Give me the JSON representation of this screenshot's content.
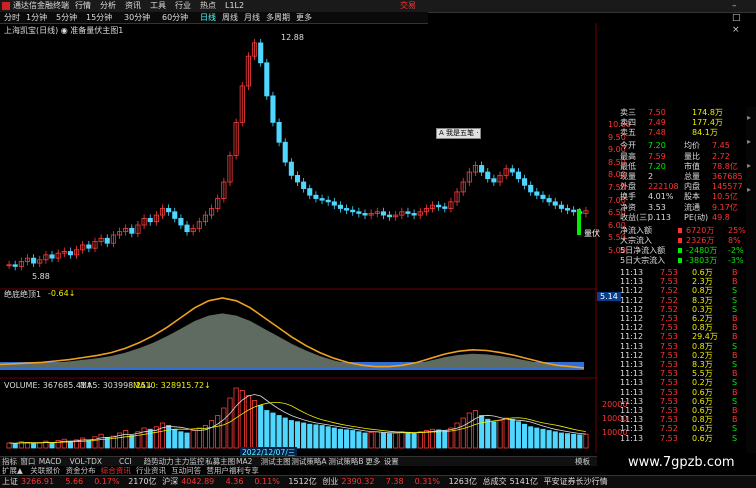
{
  "app_title": "通达信金融终端",
  "menu": [
    "行情",
    "分析",
    "资讯",
    "工具",
    "行业",
    "热点",
    "L1L2"
  ],
  "brand": "交易",
  "window_buttons": "– □ ×",
  "periods": [
    {
      "label": "分时",
      "active": false
    },
    {
      "label": "1分钟",
      "active": false
    },
    {
      "label": "5分钟",
      "active": false
    },
    {
      "label": "15分钟",
      "active": false
    },
    {
      "label": "30分钟",
      "active": false
    },
    {
      "label": "60分钟",
      "active": false
    },
    {
      "label": "日线",
      "active": true
    },
    {
      "label": "周线",
      "active": false
    },
    {
      "label": "月线",
      "active": false
    },
    {
      "label": "多周期",
      "active": false
    },
    {
      "label": "更多",
      "active": false
    }
  ],
  "stock_title": "上海凯宝(日线) ◉ 准备量伏主图1",
  "high_label": "12.88",
  "low_label": "5.88",
  "buy_label": "量伏",
  "popup": "A 我是五笔 ·",
  "indicator": {
    "title": "绝底绝顶1",
    "value": "-0.64↓",
    "side": "5.14"
  },
  "volume": {
    "title": "VOLUME: 367685.41↑",
    "ma5": "MA5: 303998.25↓",
    "ma10": "MA10: 328915.72↓"
  },
  "axis_price": [
    "10.00",
    "9.50",
    "9.00",
    "8.50",
    "8.00",
    "7.50",
    "7.00",
    "6.50",
    "6.00",
    "5.50",
    "5.00"
  ],
  "axis_volume": [
    "20000",
    "10000",
    "10000"
  ],
  "quote_rows": [
    {
      "label": "卖三",
      "price": "7.50",
      "vol": "174.8万",
      "pc": "red"
    },
    {
      "label": "卖四",
      "price": "7.49",
      "vol": "177.4万",
      "pc": "red"
    },
    {
      "label": "卖五",
      "price": "7.48",
      "vol": "84.1万",
      "pc": "red"
    },
    {
      "label": "今开",
      "price": "7.20",
      "label2": "均价",
      "val2": "7.45",
      "pc": "green"
    },
    {
      "label": "最高",
      "price": "7.59",
      "label2": "量比",
      "val2": "2.72",
      "pc": "red"
    },
    {
      "label": "最低",
      "price": "7.20",
      "label2": "市值",
      "val2": "78.8亿",
      "pc": "green"
    },
    {
      "label": "现量",
      "price": "2",
      "label2": "总量",
      "val2": "367685",
      "pc": "white"
    },
    {
      "label": "外盘",
      "price": "222108",
      "label2": "内盘",
      "val2": "145577",
      "pc": "red"
    },
    {
      "label": "换手",
      "price": "4.01%",
      "label2": "股本",
      "val2": "10.5亿",
      "pc": "white"
    },
    {
      "label": "净资",
      "price": "3.53",
      "label2": "流通",
      "val2": "9.17亿",
      "pc": "white"
    },
    {
      "label": "收益(三)",
      "price": "0.113",
      "label2": "PE(动)",
      "val2": "49.8",
      "pc": "white"
    }
  ],
  "flow_rows": [
    {
      "label": "净流入额",
      "val": "6720万",
      "pct": "25%",
      "c": "red"
    },
    {
      "label": "大宗流入",
      "val": "2326万",
      "pct": "8%",
      "c": "red"
    },
    {
      "label": "5日净流入额",
      "val": "-2480万",
      "pct": "-2%",
      "c": "green"
    },
    {
      "label": "5日大宗流入",
      "val": "-3803万",
      "pct": "-3%",
      "c": "green"
    }
  ],
  "ticks": [
    {
      "t": "11:13",
      "p": "7.53",
      "v": "0.6万",
      "f": "B",
      "c": "red"
    },
    {
      "t": "11:13",
      "p": "7.53",
      "v": "2.3万",
      "f": "B",
      "c": "red"
    },
    {
      "t": "11:12",
      "p": "7.52",
      "v": "0.8万",
      "f": "S",
      "c": "red"
    },
    {
      "t": "11:12",
      "p": "7.52",
      "v": "8.3万",
      "f": "S",
      "c": "red"
    },
    {
      "t": "11:12",
      "p": "7.52",
      "v": "0.3万",
      "f": "S",
      "c": "red"
    },
    {
      "t": "11:12",
      "p": "7.53",
      "v": "6.2万",
      "f": "B",
      "c": "red"
    },
    {
      "t": "11:12",
      "p": "7.53",
      "v": "0.8万",
      "f": "B",
      "c": "red"
    },
    {
      "t": "11:12",
      "p": "7.53",
      "v": "29.4万",
      "f": "B",
      "c": "red"
    },
    {
      "t": "11:13",
      "p": "7.53",
      "v": "0.8万",
      "f": "S",
      "c": "red"
    },
    {
      "t": "11:12",
      "p": "7.53",
      "v": "0.2万",
      "f": "B",
      "c": "red"
    },
    {
      "t": "11:13",
      "p": "7.53",
      "v": "8.3万",
      "f": "S",
      "c": "red"
    },
    {
      "t": "11:13",
      "p": "7.53",
      "v": "5.5万",
      "f": "B",
      "c": "red"
    },
    {
      "t": "11:13",
      "p": "7.53",
      "v": "0.2万",
      "f": "S",
      "c": "red"
    },
    {
      "t": "11:13",
      "p": "7.53",
      "v": "0.6万",
      "f": "B",
      "c": "red"
    },
    {
      "t": "11:13",
      "p": "7.53",
      "v": "0.6万",
      "f": "S",
      "c": "red"
    },
    {
      "t": "11:13",
      "p": "7.53",
      "v": "0.6万",
      "f": "B",
      "c": "red"
    },
    {
      "t": "11:13",
      "p": "7.53",
      "v": "0.8万",
      "f": "B",
      "c": "red"
    },
    {
      "t": "11:13",
      "p": "7.52",
      "v": "0.6万",
      "f": "S",
      "c": "red"
    },
    {
      "t": "11:13",
      "p": "7.53",
      "v": "0.6万",
      "f": "S",
      "c": "red"
    }
  ],
  "date_tag": "2022/12/07/三",
  "tabs": [
    "指标",
    "窗口",
    "MACD",
    "VOL-TDX",
    "CCI",
    "趋势动力",
    "主力监控",
    "私募主图",
    "MA2",
    "测试主图",
    "测试策略A",
    "测试策略B",
    "更多",
    "设置"
  ],
  "tabs2": [
    "扩展▲",
    "关联报价",
    "资金分布",
    "综合资讯",
    "行业资讯",
    "互动问答",
    "营用户福利专享"
  ],
  "tabs_right": "模板",
  "status": [
    {
      "label": "上证",
      "val": "3266.91",
      "c": "red"
    },
    {
      "label": "",
      "val": "5.66",
      "c": "red"
    },
    {
      "label": "",
      "val": "0.17%",
      "c": "red"
    },
    {
      "label": "",
      "val": "2170亿",
      "c": "white"
    },
    {
      "label": "沪深",
      "val": "4042.89",
      "c": "red"
    },
    {
      "label": "",
      "val": "4.36",
      "c": "red"
    },
    {
      "label": "",
      "val": "0.11%",
      "c": "red"
    },
    {
      "label": "",
      "val": "1512亿",
      "c": "white"
    },
    {
      "label": "创业",
      "val": "2390.32",
      "c": "red"
    },
    {
      "label": "",
      "val": "7.38",
      "c": "red"
    },
    {
      "label": "",
      "val": "0.31%",
      "c": "red"
    },
    {
      "label": "",
      "val": "1263亿",
      "c": "white"
    },
    {
      "label": "总成交",
      "val": "5141亿",
      "c": "white"
    },
    {
      "label": "平安证券长沙行情",
      "val": "",
      "c": "white"
    }
  ],
  "watermark": "www.7gpzb.com",
  "chart_data": {
    "type": "candlestick",
    "price_min": 5.0,
    "price_max": 10.3,
    "high_mark": 12.88,
    "closes": [
      5.9,
      5.85,
      6.0,
      6.1,
      5.95,
      6.05,
      6.2,
      6.1,
      6.25,
      6.3,
      6.2,
      6.35,
      6.5,
      6.4,
      6.6,
      6.7,
      6.55,
      6.8,
      6.9,
      7.0,
      6.85,
      7.1,
      7.3,
      7.2,
      7.4,
      7.6,
      7.5,
      7.3,
      7.1,
      6.9,
      7.0,
      7.2,
      7.4,
      7.6,
      7.9,
      8.4,
      9.2,
      10.2,
      11.3,
      12.2,
      12.6,
      12.0,
      11.0,
      10.2,
      9.6,
      9.0,
      8.6,
      8.4,
      8.2,
      8.0,
      7.9,
      7.85,
      7.8,
      7.7,
      7.6,
      7.55,
      7.5,
      7.45,
      7.4,
      7.45,
      7.5,
      7.4,
      7.35,
      7.4,
      7.5,
      7.45,
      7.4,
      7.5,
      7.6,
      7.7,
      7.65,
      7.6,
      7.8,
      8.1,
      8.4,
      8.7,
      8.9,
      8.7,
      8.5,
      8.4,
      8.6,
      8.8,
      8.7,
      8.5,
      8.3,
      8.1,
      8.0,
      7.9,
      7.8,
      7.7,
      7.6,
      7.55,
      7.5,
      7.45,
      7.53
    ],
    "volumes": [
      40,
      35,
      50,
      45,
      38,
      42,
      55,
      40,
      60,
      70,
      50,
      65,
      80,
      60,
      90,
      110,
      85,
      95,
      120,
      140,
      100,
      130,
      160,
      150,
      170,
      200,
      180,
      150,
      130,
      120,
      140,
      160,
      180,
      220,
      260,
      320,
      400,
      480,
      460,
      420,
      380,
      340,
      300,
      280,
      260,
      240,
      220,
      210,
      200,
      190,
      185,
      180,
      170,
      160,
      150,
      145,
      140,
      130,
      120,
      125,
      130,
      120,
      115,
      120,
      130,
      125,
      120,
      130,
      140,
      150,
      145,
      140,
      160,
      200,
      240,
      280,
      300,
      260,
      230,
      210,
      220,
      240,
      230,
      210,
      190,
      170,
      160,
      150,
      140,
      130,
      120,
      115,
      110,
      105,
      110
    ],
    "indicator_curve": [
      0.05,
      0.06,
      0.07,
      0.08,
      0.1,
      0.12,
      0.15,
      0.18,
      0.22,
      0.28,
      0.36,
      0.46,
      0.58,
      0.72,
      0.86,
      0.96,
      1.0,
      0.96,
      0.86,
      0.72,
      0.58,
      0.44,
      0.32,
      0.22,
      0.14,
      0.08,
      0.04,
      0.02,
      0.02,
      0.04,
      0.08,
      0.14,
      0.2,
      0.24,
      0.26,
      0.25,
      0.22,
      0.18,
      0.13,
      0.08,
      0.04,
      0.02,
      0.0
    ]
  }
}
